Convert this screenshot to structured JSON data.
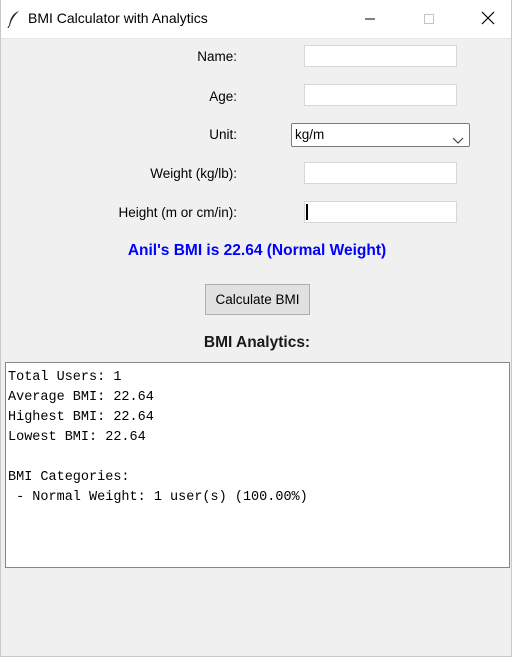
{
  "window": {
    "title": "BMI Calculator with Analytics"
  },
  "form": {
    "name_label": "Name:",
    "name_value": "",
    "age_label": "Age:",
    "age_value": "",
    "unit_label": "Unit:",
    "unit_value": "kg/m",
    "weight_label": "Weight (kg/lb):",
    "weight_value": "",
    "height_label": "Height (m or cm/in):",
    "height_value": ""
  },
  "result": {
    "text": "Anil's BMI is 22.64 (Normal Weight)",
    "color": "#0000ff"
  },
  "calculate_button": {
    "label": "Calculate BMI"
  },
  "analytics": {
    "heading": "BMI Analytics:",
    "lines": [
      "Total Users: 1",
      "Average BMI: 22.64",
      "Highest BMI: 22.64",
      "Lowest BMI: 22.64",
      "",
      "BMI Categories:",
      " - Normal Weight: 1 user(s) (100.00%)"
    ]
  },
  "icons": {
    "app": "feather-icon",
    "minimize": "minimize-icon",
    "maximize": "maximize-icon",
    "close": "close-icon",
    "dropdown": "chevron-down-icon"
  }
}
